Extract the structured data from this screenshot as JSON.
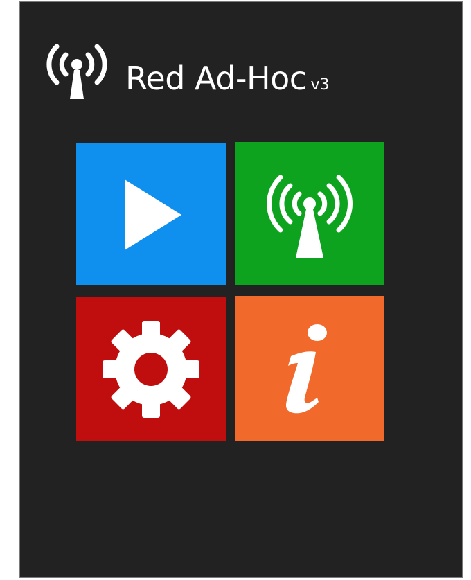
{
  "app": {
    "title": "Red Ad-Hoc",
    "version": "v3"
  },
  "tiles": [
    {
      "id": "play",
      "icon": "play-icon",
      "color": "#0f8fee"
    },
    {
      "id": "network",
      "icon": "antenna-icon",
      "color": "#0da31e"
    },
    {
      "id": "settings",
      "icon": "gear-icon",
      "color": "#c00d0d"
    },
    {
      "id": "info",
      "icon": "info-icon",
      "color": "#f16a2c"
    }
  ],
  "colors": {
    "background": "#222222",
    "foreground": "#ffffff"
  }
}
